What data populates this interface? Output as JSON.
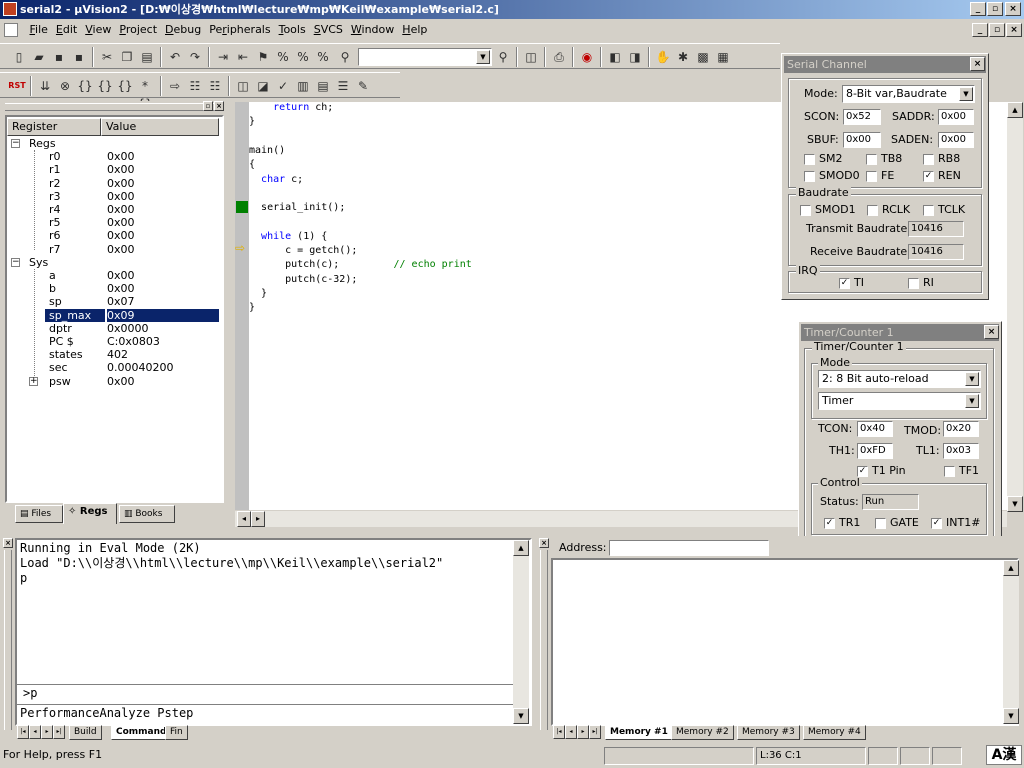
{
  "window": {
    "title": "serial2 - µVision2 - [D:₩이상경₩html₩lecture₩mp₩Keil₩example₩serial2.c]"
  },
  "menu": [
    {
      "key": "F",
      "label": "File"
    },
    {
      "key": "E",
      "label": "Edit"
    },
    {
      "key": "V",
      "label": "View"
    },
    {
      "key": "P",
      "label": "Project"
    },
    {
      "key": "D",
      "label": "Debug"
    },
    {
      "key": "r",
      "label": "Peripherals"
    },
    {
      "key": "T",
      "label": "Tools"
    },
    {
      "key": "S",
      "label": "SVCS"
    },
    {
      "key": "W",
      "label": "Window"
    },
    {
      "key": "H",
      "label": "Help"
    }
  ],
  "toolbar": {
    "rst_label": "RST"
  },
  "registers": {
    "col_register": "Register",
    "col_value": "Value",
    "groups": {
      "regs": "Regs",
      "sys": "Sys"
    },
    "regs": [
      {
        "name": "r0",
        "value": "0x00"
      },
      {
        "name": "r1",
        "value": "0x00"
      },
      {
        "name": "r2",
        "value": "0x00"
      },
      {
        "name": "r3",
        "value": "0x00"
      },
      {
        "name": "r4",
        "value": "0x00"
      },
      {
        "name": "r5",
        "value": "0x00"
      },
      {
        "name": "r6",
        "value": "0x00"
      },
      {
        "name": "r7",
        "value": "0x00"
      }
    ],
    "sys": [
      {
        "name": "a",
        "value": "0x00"
      },
      {
        "name": "b",
        "value": "0x00"
      },
      {
        "name": "sp",
        "value": "0x07"
      },
      {
        "name": "sp_max",
        "value": "0x09"
      },
      {
        "name": "dptr",
        "value": "0x0000"
      },
      {
        "name": "PC  $",
        "value": "C:0x0803"
      },
      {
        "name": "states",
        "value": "402"
      },
      {
        "name": "sec",
        "value": "0.00040200"
      },
      {
        "name": "psw",
        "value": "0x00"
      }
    ],
    "selected": "sp_max"
  },
  "project_tabs": [
    "Files",
    "Regs",
    "Books"
  ],
  "editor": {
    "lines": [
      {
        "indent": "    ",
        "kw": "return",
        "text": " ch;",
        "comment": ""
      },
      {
        "indent": "",
        "kw": "",
        "text": "}",
        "comment": ""
      },
      {
        "indent": "",
        "kw": "",
        "text": "",
        "comment": ""
      },
      {
        "indent": "",
        "kw": "",
        "text": "main()",
        "comment": ""
      },
      {
        "indent": "",
        "kw": "",
        "text": "{",
        "comment": ""
      },
      {
        "indent": "  ",
        "kw": "char",
        "text": " c;",
        "comment": ""
      },
      {
        "indent": "",
        "kw": "",
        "text": "",
        "comment": ""
      },
      {
        "indent": "  ",
        "kw": "",
        "text": "serial_init();",
        "comment": ""
      },
      {
        "indent": "",
        "kw": "",
        "text": "",
        "comment": ""
      },
      {
        "indent": "  ",
        "kw": "while",
        "text": " (1) {",
        "comment": ""
      },
      {
        "indent": "      ",
        "kw": "",
        "text": "c = getch();",
        "comment": ""
      },
      {
        "indent": "      ",
        "kw": "",
        "text": "putch(c);         ",
        "comment": "// echo print"
      },
      {
        "indent": "      ",
        "kw": "",
        "text": "putch(c-32);",
        "comment": ""
      },
      {
        "indent": "  ",
        "kw": "",
        "text": "}",
        "comment": ""
      },
      {
        "indent": "",
        "kw": "",
        "text": "}",
        "comment": ""
      }
    ]
  },
  "serial": {
    "title": "Serial Channel",
    "mode_label": "Mode:",
    "mode_value": "8-Bit var,Baudrate",
    "scon_label": "SCON:",
    "scon_value": "0x52",
    "saddr_label": "SADDR:",
    "saddr_value": "0x00",
    "sbuf_label": "SBUF:",
    "sbuf_value": "0x00",
    "saden_label": "SADEN:",
    "saden_value": "0x00",
    "checks": [
      {
        "label": "SM2",
        "checked": false
      },
      {
        "label": "TB8",
        "checked": false
      },
      {
        "label": "RB8",
        "checked": false
      },
      {
        "label": "SMOD0",
        "checked": false
      },
      {
        "label": "FE",
        "checked": false
      },
      {
        "label": "REN",
        "checked": true
      }
    ],
    "baud_group": "Baudrate",
    "baud_checks": [
      {
        "label": "SMOD1",
        "checked": false
      },
      {
        "label": "RCLK",
        "checked": false
      },
      {
        "label": "TCLK",
        "checked": false
      }
    ],
    "tx_label": "Transmit Baudrate:",
    "tx_value": "10416",
    "rx_label": "Receive Baudrate:",
    "rx_value": "10416",
    "irq_group": "IRQ",
    "irq_checks": [
      {
        "label": "TI",
        "checked": true
      },
      {
        "label": "RI",
        "checked": false
      }
    ]
  },
  "timer": {
    "title": "Timer/Counter 1",
    "group_title": "Timer/Counter 1",
    "mode_group": "Mode",
    "mode_value": "2: 8 Bit auto-reload",
    "type_value": "Timer",
    "tcon_label": "TCON:",
    "tcon_value": "0x40",
    "tmod_label": "TMOD:",
    "tmod_value": "0x20",
    "th1_label": "TH1:",
    "th1_value": "0xFD",
    "tl1_label": "TL1:",
    "tl1_value": "0x03",
    "t1pin_label": "T1 Pin",
    "t1pin_checked": true,
    "tf1_label": "TF1",
    "tf1_checked": false,
    "control_group": "Control",
    "status_label": "Status:",
    "status_value": "Run",
    "control_checks": [
      {
        "label": "TR1",
        "checked": true
      },
      {
        "label": "GATE",
        "checked": false
      },
      {
        "label": "INT1#",
        "checked": true
      }
    ]
  },
  "output": {
    "lines": [
      "Running in Eval Mode (2K)",
      "Load \"D:\\\\이상경\\\\html\\\\lecture\\\\mp\\\\Keil\\\\example\\\\serial2\"",
      "p"
    ],
    "command_prompt": ">p",
    "autocomplete": "PerformanceAnalyze Pstep",
    "tabs": [
      "Build",
      "Command",
      "Fin"
    ]
  },
  "memory": {
    "address_label": "Address:",
    "address_value": "",
    "tabs": [
      "Memory #1",
      "Memory #2",
      "Memory #3",
      "Memory #4"
    ]
  },
  "status": {
    "help": "For Help, press F1",
    "position": "L:36 C:1",
    "ime": "A漢"
  }
}
